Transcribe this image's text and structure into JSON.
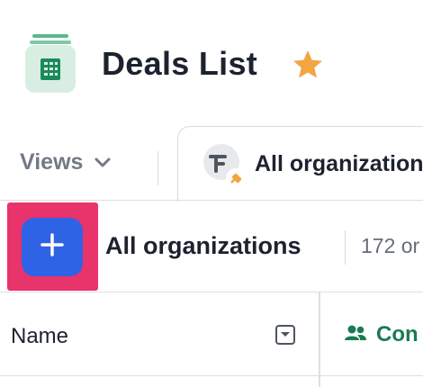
{
  "header": {
    "title": "Deals List",
    "app_icon": "building-icon",
    "star_icon": "star-icon",
    "star_color": "#f2a541"
  },
  "views_bar": {
    "views_label": "Views",
    "active_tab_label": "All organizations"
  },
  "toolbar": {
    "add_button_icon": "plus-icon",
    "list_title": "All organizations",
    "count_text": "172 or"
  },
  "table": {
    "columns": [
      {
        "label": "Name"
      },
      {
        "label": "Con",
        "icon": "people-icon"
      }
    ]
  },
  "colors": {
    "accent_blue": "#2f63e6",
    "highlight": "#e8336b",
    "contact_green": "#1b7a52",
    "app_tile": "#d8eee3"
  }
}
